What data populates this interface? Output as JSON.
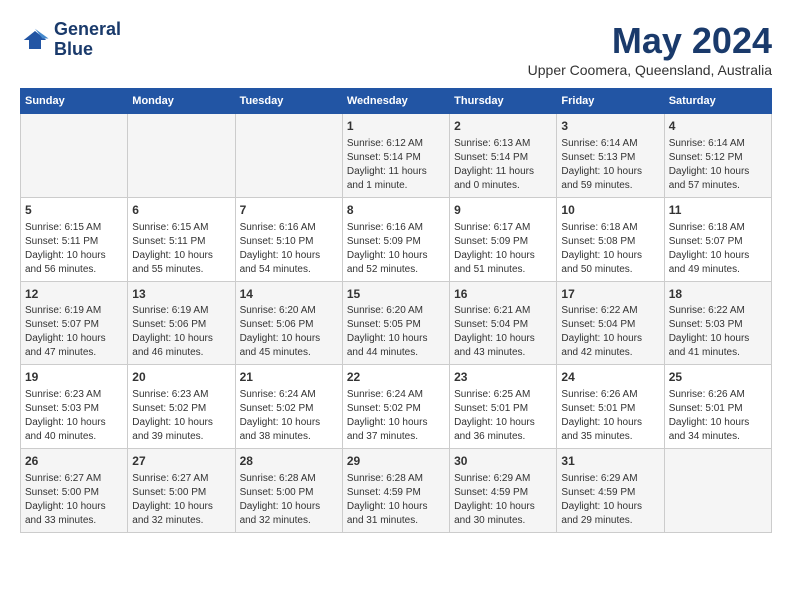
{
  "logo": {
    "line1": "General",
    "line2": "Blue"
  },
  "title": "May 2024",
  "location": "Upper Coomera, Queensland, Australia",
  "weekdays": [
    "Sunday",
    "Monday",
    "Tuesday",
    "Wednesday",
    "Thursday",
    "Friday",
    "Saturday"
  ],
  "weeks": [
    [
      {
        "day": "",
        "info": ""
      },
      {
        "day": "",
        "info": ""
      },
      {
        "day": "",
        "info": ""
      },
      {
        "day": "1",
        "info": "Sunrise: 6:12 AM\nSunset: 5:14 PM\nDaylight: 11 hours\nand 1 minute."
      },
      {
        "day": "2",
        "info": "Sunrise: 6:13 AM\nSunset: 5:14 PM\nDaylight: 11 hours\nand 0 minutes."
      },
      {
        "day": "3",
        "info": "Sunrise: 6:14 AM\nSunset: 5:13 PM\nDaylight: 10 hours\nand 59 minutes."
      },
      {
        "day": "4",
        "info": "Sunrise: 6:14 AM\nSunset: 5:12 PM\nDaylight: 10 hours\nand 57 minutes."
      }
    ],
    [
      {
        "day": "5",
        "info": "Sunrise: 6:15 AM\nSunset: 5:11 PM\nDaylight: 10 hours\nand 56 minutes."
      },
      {
        "day": "6",
        "info": "Sunrise: 6:15 AM\nSunset: 5:11 PM\nDaylight: 10 hours\nand 55 minutes."
      },
      {
        "day": "7",
        "info": "Sunrise: 6:16 AM\nSunset: 5:10 PM\nDaylight: 10 hours\nand 54 minutes."
      },
      {
        "day": "8",
        "info": "Sunrise: 6:16 AM\nSunset: 5:09 PM\nDaylight: 10 hours\nand 52 minutes."
      },
      {
        "day": "9",
        "info": "Sunrise: 6:17 AM\nSunset: 5:09 PM\nDaylight: 10 hours\nand 51 minutes."
      },
      {
        "day": "10",
        "info": "Sunrise: 6:18 AM\nSunset: 5:08 PM\nDaylight: 10 hours\nand 50 minutes."
      },
      {
        "day": "11",
        "info": "Sunrise: 6:18 AM\nSunset: 5:07 PM\nDaylight: 10 hours\nand 49 minutes."
      }
    ],
    [
      {
        "day": "12",
        "info": "Sunrise: 6:19 AM\nSunset: 5:07 PM\nDaylight: 10 hours\nand 47 minutes."
      },
      {
        "day": "13",
        "info": "Sunrise: 6:19 AM\nSunset: 5:06 PM\nDaylight: 10 hours\nand 46 minutes."
      },
      {
        "day": "14",
        "info": "Sunrise: 6:20 AM\nSunset: 5:06 PM\nDaylight: 10 hours\nand 45 minutes."
      },
      {
        "day": "15",
        "info": "Sunrise: 6:20 AM\nSunset: 5:05 PM\nDaylight: 10 hours\nand 44 minutes."
      },
      {
        "day": "16",
        "info": "Sunrise: 6:21 AM\nSunset: 5:04 PM\nDaylight: 10 hours\nand 43 minutes."
      },
      {
        "day": "17",
        "info": "Sunrise: 6:22 AM\nSunset: 5:04 PM\nDaylight: 10 hours\nand 42 minutes."
      },
      {
        "day": "18",
        "info": "Sunrise: 6:22 AM\nSunset: 5:03 PM\nDaylight: 10 hours\nand 41 minutes."
      }
    ],
    [
      {
        "day": "19",
        "info": "Sunrise: 6:23 AM\nSunset: 5:03 PM\nDaylight: 10 hours\nand 40 minutes."
      },
      {
        "day": "20",
        "info": "Sunrise: 6:23 AM\nSunset: 5:02 PM\nDaylight: 10 hours\nand 39 minutes."
      },
      {
        "day": "21",
        "info": "Sunrise: 6:24 AM\nSunset: 5:02 PM\nDaylight: 10 hours\nand 38 minutes."
      },
      {
        "day": "22",
        "info": "Sunrise: 6:24 AM\nSunset: 5:02 PM\nDaylight: 10 hours\nand 37 minutes."
      },
      {
        "day": "23",
        "info": "Sunrise: 6:25 AM\nSunset: 5:01 PM\nDaylight: 10 hours\nand 36 minutes."
      },
      {
        "day": "24",
        "info": "Sunrise: 6:26 AM\nSunset: 5:01 PM\nDaylight: 10 hours\nand 35 minutes."
      },
      {
        "day": "25",
        "info": "Sunrise: 6:26 AM\nSunset: 5:01 PM\nDaylight: 10 hours\nand 34 minutes."
      }
    ],
    [
      {
        "day": "26",
        "info": "Sunrise: 6:27 AM\nSunset: 5:00 PM\nDaylight: 10 hours\nand 33 minutes."
      },
      {
        "day": "27",
        "info": "Sunrise: 6:27 AM\nSunset: 5:00 PM\nDaylight: 10 hours\nand 32 minutes."
      },
      {
        "day": "28",
        "info": "Sunrise: 6:28 AM\nSunset: 5:00 PM\nDaylight: 10 hours\nand 32 minutes."
      },
      {
        "day": "29",
        "info": "Sunrise: 6:28 AM\nSunset: 4:59 PM\nDaylight: 10 hours\nand 31 minutes."
      },
      {
        "day": "30",
        "info": "Sunrise: 6:29 AM\nSunset: 4:59 PM\nDaylight: 10 hours\nand 30 minutes."
      },
      {
        "day": "31",
        "info": "Sunrise: 6:29 AM\nSunset: 4:59 PM\nDaylight: 10 hours\nand 29 minutes."
      },
      {
        "day": "",
        "info": ""
      }
    ]
  ]
}
